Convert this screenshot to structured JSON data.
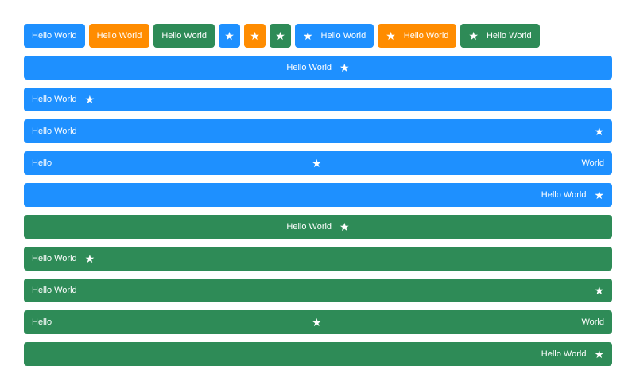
{
  "colors": {
    "blue": "#1e90ff",
    "orange": "#ff8c00",
    "green": "#2e8b57",
    "text": "#ffffff"
  },
  "top_row": {
    "btn1_label": "Hello World",
    "btn2_label": "Hello World",
    "btn3_label": "Hello World",
    "btn4_icon": "star-icon",
    "btn5_icon": "star-icon",
    "btn6_icon": "star-icon",
    "btn7_label": "Hello World",
    "btn8_label": "Hello World",
    "btn9_label": "Hello World",
    "star_glyph": "★"
  },
  "bars": [
    {
      "label": "Hello World"
    },
    {
      "label": "Hello World"
    },
    {
      "label": "Hello World"
    },
    {
      "label_left": "Hello",
      "label_right": "World"
    },
    {
      "label": "Hello World"
    },
    {
      "label": "Hello World"
    },
    {
      "label": "Hello World"
    },
    {
      "label": "Hello World"
    },
    {
      "label_left": "Hello",
      "label_right": "World"
    },
    {
      "label": "Hello World"
    }
  ]
}
